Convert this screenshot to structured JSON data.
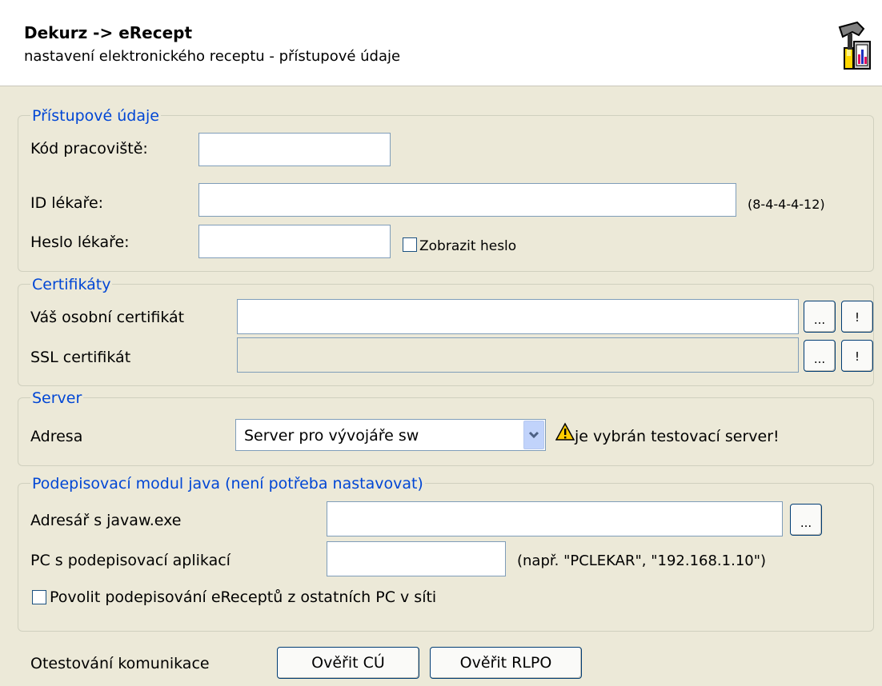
{
  "header": {
    "title": "Dekurz -> eRecept",
    "subtitle": "nastavení elektronického receptu - přístupové údaje",
    "icon": "wizard-icon"
  },
  "access": {
    "legend": "Přístupové údaje",
    "workplace_code_label": "Kód pracoviště:",
    "workplace_code_value": "",
    "doctor_id_label": "ID lékaře:",
    "doctor_id_value": "",
    "doctor_id_hint": "(8-4-4-4-12)",
    "doctor_password_label": "Heslo lékaře:",
    "doctor_password_value": "",
    "show_password_label": "Zobrazit heslo",
    "show_password_checked": false
  },
  "certificates": {
    "legend": "Certifikáty",
    "personal_label": "Váš osobní certifikát",
    "personal_value": "",
    "ssl_label": "SSL certifikát",
    "ssl_value": "",
    "browse_label": "...",
    "info_label": "!"
  },
  "server": {
    "legend": "Server",
    "address_label": "Adresa",
    "selected": "Server pro vývojáře sw",
    "warning": "je vybrán testovací server!"
  },
  "java": {
    "legend": "Podepisovací modul java (není potřeba nastavovat)",
    "javaw_dir_label": "Adresář s javaw.exe",
    "javaw_dir_value": "",
    "browse_label": "...",
    "signing_pc_label": "PC s podepisovací aplikací",
    "signing_pc_value": "",
    "signing_pc_hint": "(např. \"PCLEKAR\", \"192.168.1.10\")",
    "allow_remote_label": "Povolit podepisování eReceptů z ostatních PC v síti",
    "allow_remote_checked": false
  },
  "test": {
    "label": "Otestování komunikace",
    "verify_cu": "Ověřit CÚ",
    "verify_rlpo": "Ověřit RLPO"
  },
  "colors": {
    "background": "#ece9d8",
    "legend": "#0046d5",
    "input_border": "#7f9db9",
    "button_border": "#003c74"
  }
}
